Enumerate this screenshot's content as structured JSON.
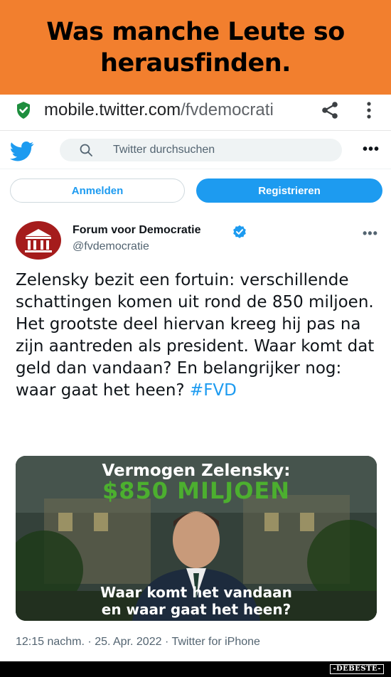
{
  "caption": {
    "line1": "Was manche Leute so",
    "line2": "herausfinden."
  },
  "browser": {
    "url_host": "mobile.twitter.com",
    "url_path": "/fvdemocrati",
    "icons": [
      "shield-icon",
      "share-icon",
      "more-vert-icon"
    ]
  },
  "twitter_header": {
    "logo_icon": "twitter-bird-icon",
    "search_placeholder": "Twitter durchsuchen",
    "more_label": "•••"
  },
  "auth": {
    "login_label": "Anmelden",
    "register_label": "Registrieren"
  },
  "tweet": {
    "author_name": "Forum voor Democratie",
    "handle": "@fvdemocratie",
    "verified": true,
    "more_label": "•••",
    "text": "Zelensky bezit een fortuin: verschillende schattingen komen uit rond de 850 miljoen. Het grootste deel hiervan kreeg hij pas na zijn aantreden als president. Waar komt dat geld dan vandaan? En belangrijker nog: waar gaat het heen?",
    "hashtag": "#FVD",
    "media": {
      "title": "Vermogen Zelensky:",
      "amount": "$850 MILJOEN",
      "question_line1": "Waar komt het vandaan",
      "question_line2": "en waar gaat het heen?"
    },
    "time": "12:15 nachm.",
    "separator": "·",
    "date": "25. Apr. 2022",
    "source": "Twitter for iPhone"
  },
  "watermark": "-DEBESTE-",
  "colors": {
    "banner": "#f27f2e",
    "twitter_blue": "#1d9bf0",
    "money_green": "#4caf2f",
    "avatar_red": "#a51c1c"
  }
}
